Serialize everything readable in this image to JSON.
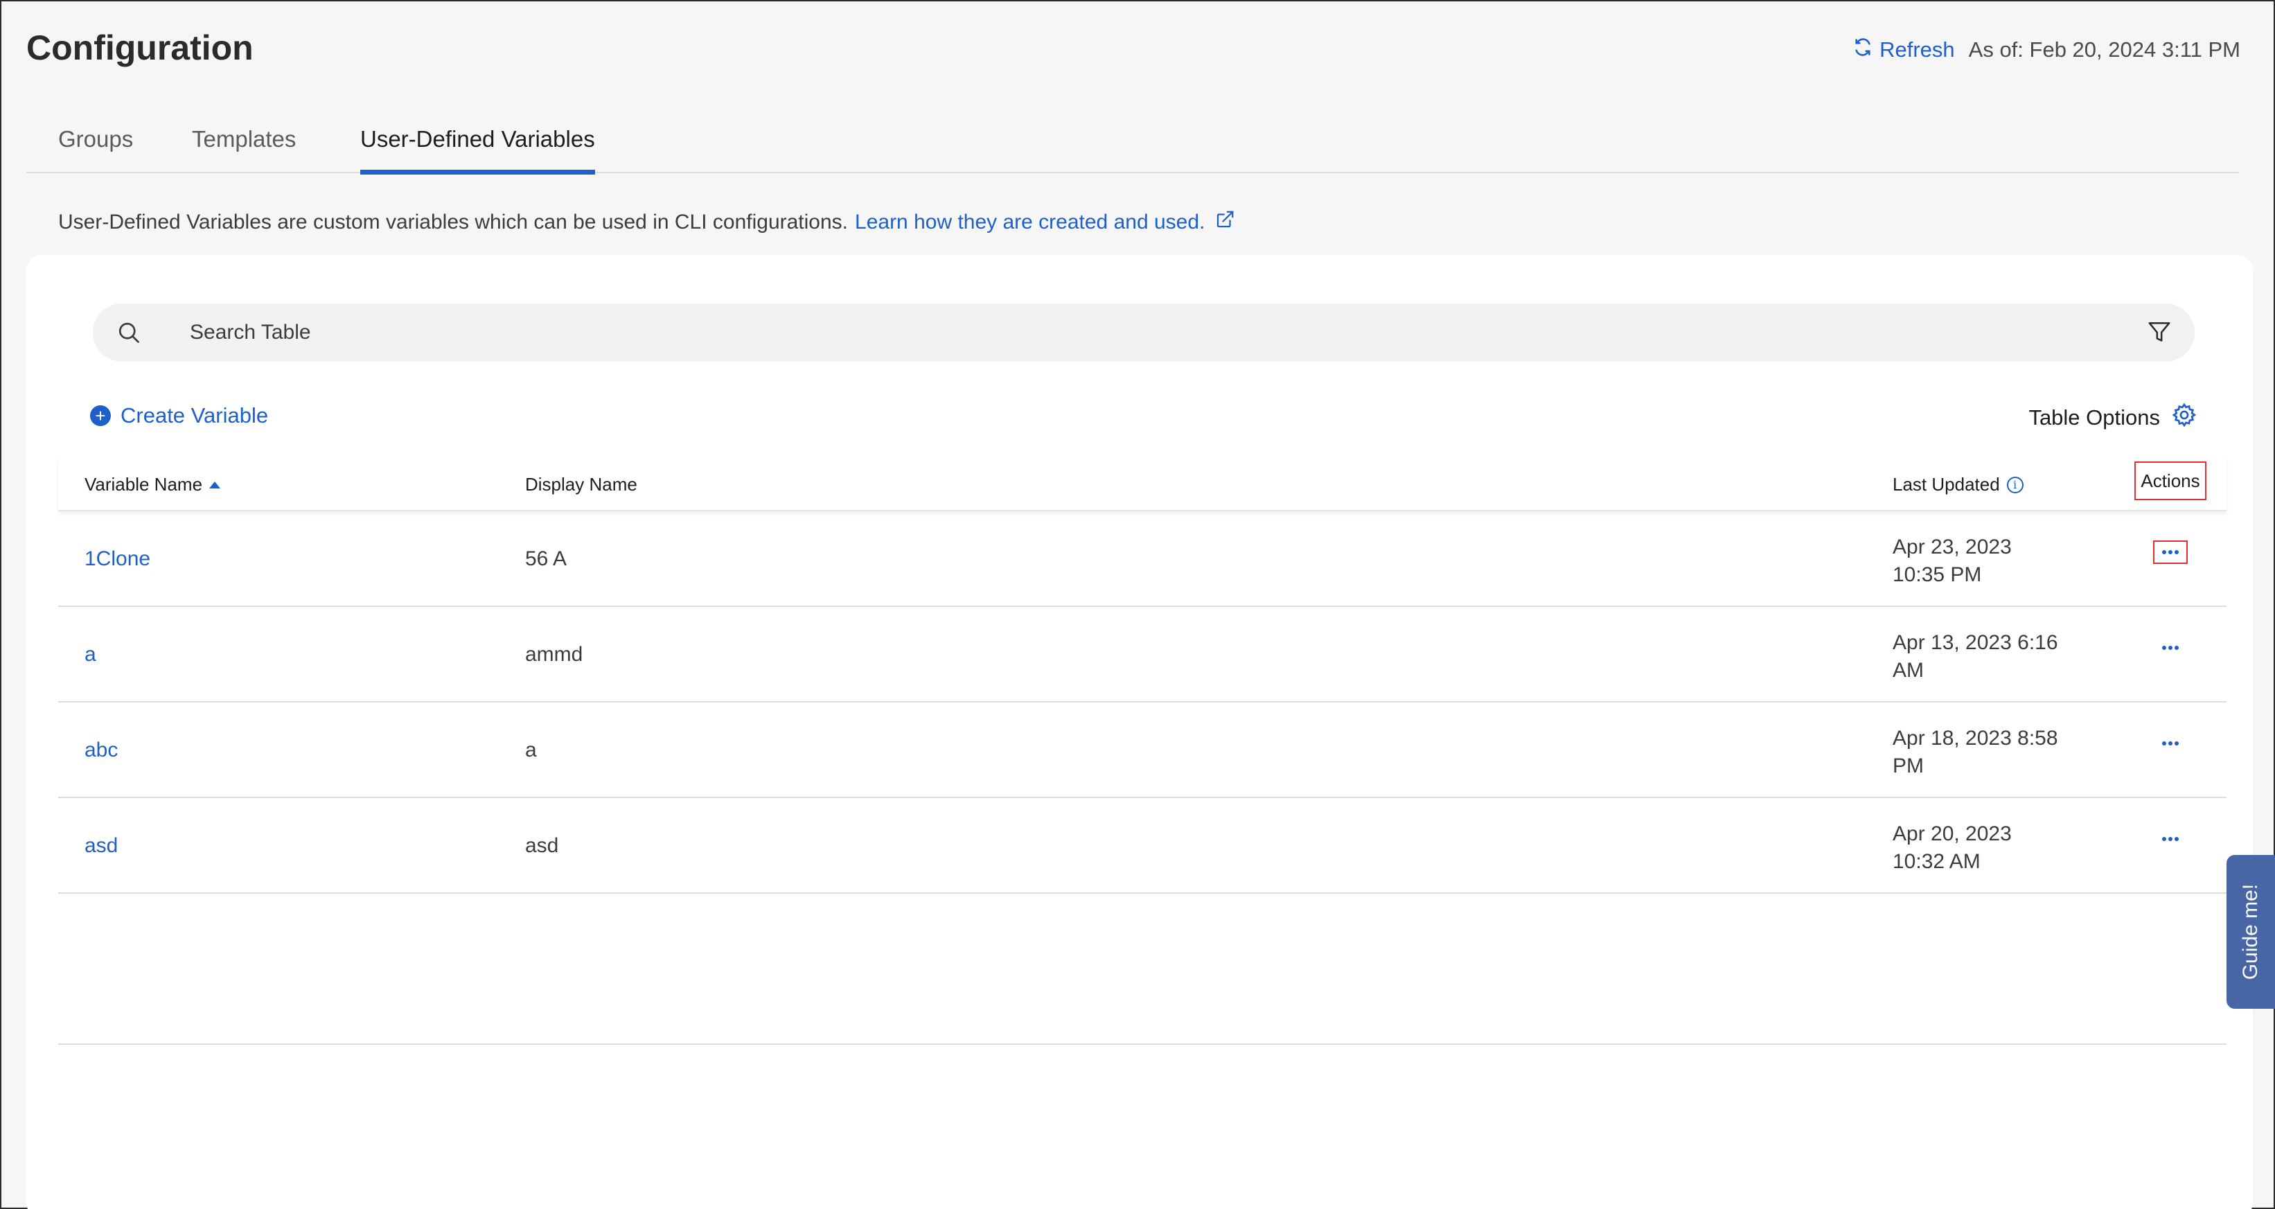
{
  "header": {
    "title": "Configuration",
    "refresh_label": "Refresh",
    "as_of": "As of: Feb 20, 2024 3:11 PM"
  },
  "tabs": [
    {
      "label": "Groups",
      "active": false
    },
    {
      "label": "Templates",
      "active": false
    },
    {
      "label": "User-Defined Variables",
      "active": true
    }
  ],
  "description": {
    "text": "User-Defined Variables are custom variables which can be used in CLI configurations.",
    "link_text": "Learn how they are created and used."
  },
  "search": {
    "placeholder": "Search Table"
  },
  "toolbar": {
    "create_label": "Create Variable",
    "table_options_label": "Table Options"
  },
  "table": {
    "columns": {
      "variable_name": "Variable Name",
      "display_name": "Display Name",
      "last_updated": "Last Updated",
      "actions": "Actions"
    },
    "rows": [
      {
        "name": "1Clone",
        "display": "56 A",
        "updated_line1": "Apr 23, 2023",
        "updated_line2": "10:35 PM"
      },
      {
        "name": "a",
        "display": "ammd",
        "updated_line1": "Apr 13, 2023 6:16",
        "updated_line2": "AM"
      },
      {
        "name": "abc",
        "display": "a",
        "updated_line1": "Apr 18, 2023 8:58",
        "updated_line2": "PM"
      },
      {
        "name": "asd",
        "display": "asd",
        "updated_line1": "Apr 20, 2023",
        "updated_line2": "10:32 AM"
      }
    ]
  },
  "guide": {
    "label": "Guide me!"
  },
  "colors": {
    "accent": "#1f5fc9",
    "highlight": "#e03030",
    "guide_bg": "#4866a5"
  }
}
